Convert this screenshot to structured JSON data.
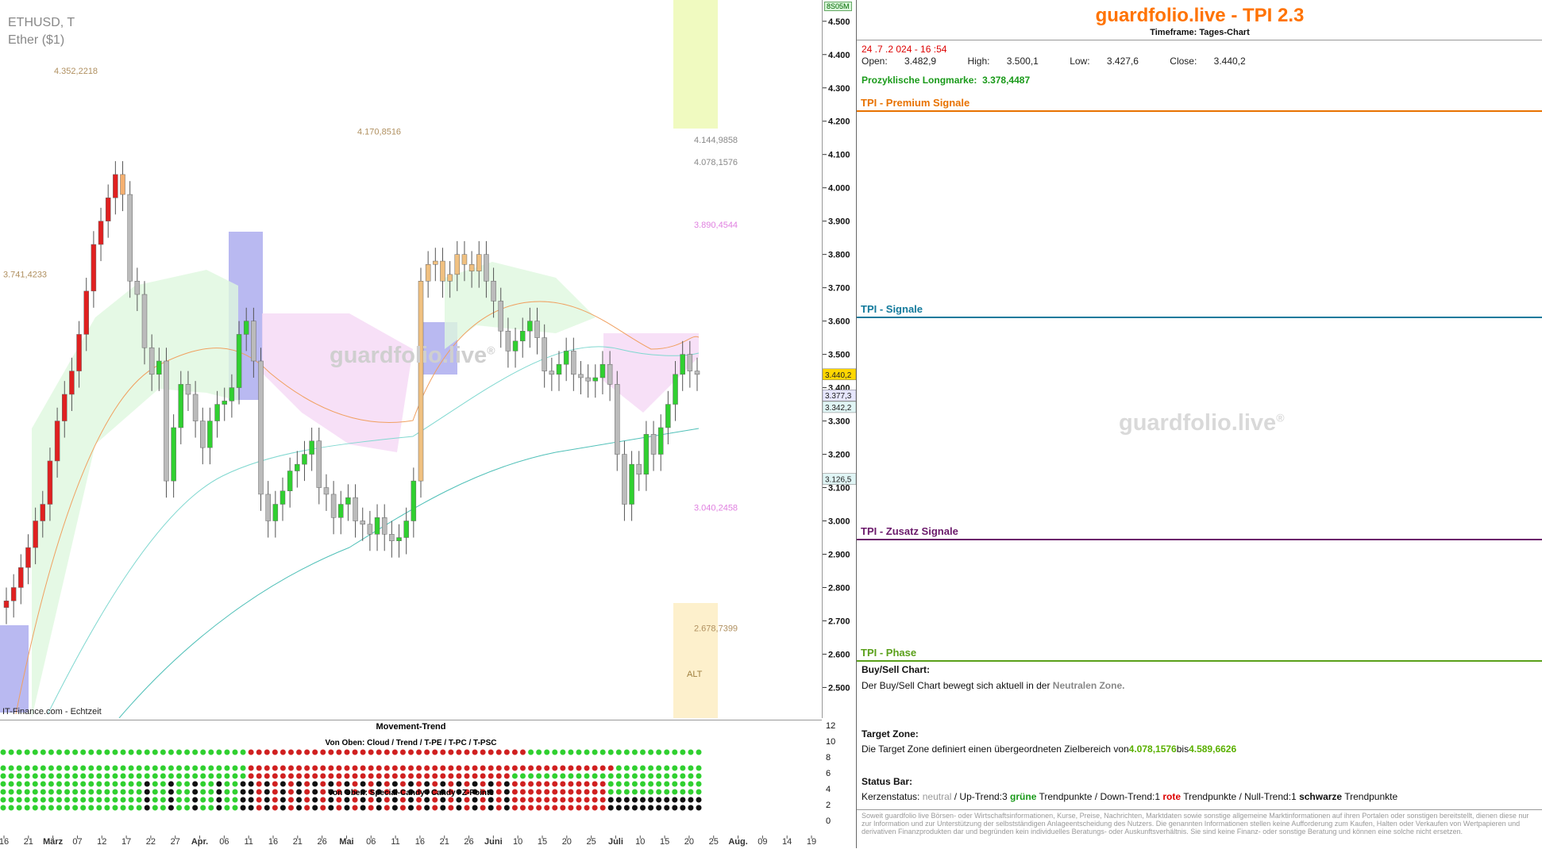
{
  "chart_header": {
    "symbol": "ETHUSD, T",
    "name": "Ether ($1)",
    "source": "IT-Finance.com - Echtzeit",
    "watermark": "guardfolio.live",
    "watermark_symbol": "®",
    "alt_label": "ALT",
    "axis_badge": "8S05M"
  },
  "chart_data": {
    "type": "candlestick",
    "ylim": [
      2420,
      4540
    ],
    "y_ticks": [
      2500,
      2600,
      2700,
      2800,
      2900,
      3000,
      3100,
      3200,
      3300,
      3400,
      3500,
      3600,
      3700,
      3800,
      3900,
      4000,
      4100,
      4200,
      4300,
      4400,
      4500
    ],
    "y_tick_labels": [
      "2.500",
      "2.600",
      "2.700",
      "2.800",
      "2.900",
      "3.000",
      "3.100",
      "3.200",
      "3.300",
      "3.400",
      "3.500",
      "3.600",
      "3.700",
      "3.800",
      "3.900",
      "4.000",
      "4.100",
      "4.200",
      "4.300",
      "4.400",
      "4.500"
    ],
    "x_tick_labels": [
      "16",
      "21",
      "März",
      "07",
      "12",
      "17",
      "22",
      "27",
      "Apr.",
      "06",
      "11",
      "16",
      "21",
      "26",
      "Mai",
      "06",
      "11",
      "16",
      "21",
      "26",
      "Juni",
      "10",
      "15",
      "20",
      "25",
      "Juli",
      "10",
      "15",
      "20",
      "25",
      "Aug.",
      "09",
      "14",
      "19"
    ],
    "x_tick_bold": [
      "März",
      "Apr.",
      "Mai",
      "Juni",
      "Juli",
      "Aug."
    ],
    "price_labels": [
      {
        "text": "4.352,2218",
        "value": 4352
      },
      {
        "text": "4.170,8516",
        "value": 4170
      },
      {
        "text": "3.741,4233",
        "value": 3741
      },
      {
        "text": "4.144,9858",
        "value": 4145
      },
      {
        "text": "4.078,1576",
        "value": 4078
      },
      {
        "text": "3.890,4544",
        "value": 3890
      },
      {
        "text": "3.040,2458",
        "value": 3040
      },
      {
        "text": "2.678,7399",
        "value": 2679
      }
    ],
    "axis_markers": [
      {
        "text": "3.440,2",
        "value": 3440,
        "color": "#ffd700"
      },
      {
        "text": "3.377,3",
        "value": 3377,
        "color": "#e6e6ff"
      },
      {
        "text": "3.342,2",
        "value": 3342,
        "color": "#e0f5f5"
      },
      {
        "text": "3.126,5",
        "value": 3126,
        "color": "#e0f5f5"
      }
    ],
    "series": [
      {
        "name": "ETHUSD",
        "close": [
          2760,
          2800,
          2860,
          2920,
          3000,
          3050,
          3180,
          3300,
          3380,
          3450,
          3560,
          3690,
          3830,
          3900,
          3970,
          4040,
          3980,
          3720,
          3680,
          3520,
          3440,
          3480,
          3120,
          3280,
          3410,
          3380,
          3300,
          3220,
          3300,
          3350,
          3360,
          3400,
          3560,
          3600,
          3480,
          3080,
          3000,
          3050,
          3090,
          3150,
          3170,
          3200,
          3240,
          3100,
          3080,
          3010,
          3050,
          3070,
          3000,
          2990,
          2960,
          3010,
          2960,
          2940,
          2950,
          3000,
          3120,
          3720,
          3770,
          3780,
          3720,
          3740,
          3800,
          3770,
          3750,
          3800,
          3720,
          3660,
          3570,
          3510,
          3540,
          3570,
          3600,
          3550,
          3450,
          3440,
          3470,
          3510,
          3440,
          3430,
          3420,
          3430,
          3470,
          3410,
          3200,
          3050,
          3170,
          3140,
          3260,
          3200,
          3280,
          3350,
          3440,
          3500,
          3450,
          3440
        ]
      }
    ]
  },
  "indicator": {
    "title": "Movement-Trend",
    "subtitle1": "Von Oben: Cloud / Trend / T-PE / T-PC / T-PSC",
    "subtitle2": "Von Oben: Special-Candy / Candy / Z-Points",
    "y_labels": [
      "12",
      "10",
      "8",
      "6",
      "4",
      "2",
      "0"
    ]
  },
  "info": {
    "brand": "guardfolio.live - TPI 2.3",
    "timeframe": "Timeframe: Tages-Chart",
    "date": "24 .7 .2 024 - 16 :54",
    "open_label": "Open:",
    "open": "3.482,9",
    "high_label": "High:",
    "high": "3.500,1",
    "low_label": "Low:",
    "low": "3.427,6",
    "close_label": "Close:",
    "close": "3.440,2",
    "longmarke_label": "Prozyklische Longmarke:",
    "longmarke": "3.378,4487",
    "section_premium": "TPI - Premium Signale",
    "section_signale": "TPI - Signale",
    "section_zusatz": "TPI - Zusatz Signale",
    "section_phase": "TPI - Phase",
    "colors": {
      "premium": "#e87200",
      "signale": "#137a9c",
      "zusatz": "#6b1a6b",
      "phase": "#5aa01a"
    },
    "watermark": "guardfolio.live",
    "watermark_symbol": "®",
    "buysell_title": "Buy/Sell Chart:",
    "buysell_text": "Der Buy/Sell Chart bewegt sich aktuell in der",
    "buysell_zone": "Neutralen Zone.",
    "target_title": "Target Zone:",
    "target_text": "Die Target Zone definiert einen übergeordneten Zielbereich von",
    "target_from": "4.078,1576",
    "target_bis": "bis",
    "target_to": "4.589,6626",
    "status_title": "Status Bar:",
    "status_kerz": "Kerzenstatus:",
    "status_neutral": "neutral",
    "status_up": "/ Up-Trend:3",
    "status_gruene": "grüne",
    "status_tp1": "Trendpunkte",
    "status_down": "/ Down-Trend:1",
    "status_rote": "rote",
    "status_tp2": "Trendpunkte",
    "status_null": "/ Null-Trend:1",
    "status_schwarze": "schwarze",
    "status_tp3": "Trendpunkte",
    "disclaimer": "Soweit guardfolio live Börsen- oder Wirtschaftsinformationen, Kurse, Preise, Nachrichten, Marktdaten sowie sonstige allgemeine Marktinformationen auf ihren Portalen oder sonstigen bereitstellt, dienen diese nur zur Information und zur Unterstützung der selbstständigen Anlageentscheidung des Nutzers. Die genannten Informationen stellen keine Aufforderung zum Kaufen, Halten oder Verkaufen von Wertpapieren und derivativen Finanzprodukten dar und begründen kein individuelles Beratungs- oder Auskunftsverhältnis. Sie sind keine Finanz- oder sonstige Beratung und können eine solche nicht ersetzen."
  }
}
